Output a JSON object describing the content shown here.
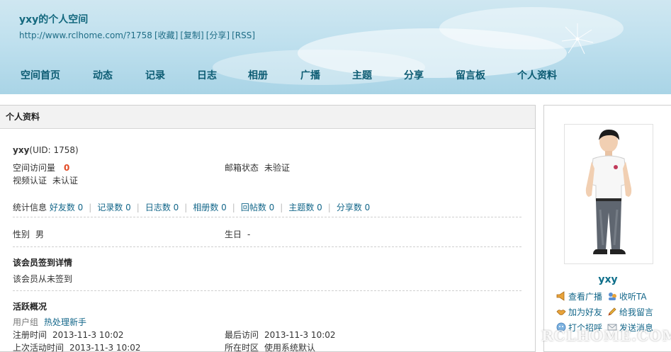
{
  "header": {
    "title": "yxy的个人空间",
    "url": "http://www.rclhome.com/?1758",
    "url_links": [
      "[收藏]",
      "[复制]",
      "[分享]",
      "[RSS]"
    ]
  },
  "nav": [
    "空间首页",
    "动态",
    "记录",
    "日志",
    "相册",
    "广播",
    "主题",
    "分享",
    "留言板",
    "个人资料"
  ],
  "main": {
    "panel_title": "个人资料",
    "user_line": "yxy",
    "uid": "(UID: 1758)",
    "visits_label": "空间访问量",
    "visits_value": "0",
    "email_label": "邮箱状态",
    "email_value": "未验证",
    "video_label": "视频认证",
    "video_value": "未认证",
    "stats_label": "统计信息",
    "stats": [
      "好友数 0",
      "记录数 0",
      "日志数 0",
      "相册数 0",
      "回帖数 0",
      "主题数 0",
      "分享数 0"
    ],
    "gender_label": "性别",
    "gender_value": "男",
    "birthday_label": "生日",
    "birthday_value": "-",
    "signin_title": "该会员签到详情",
    "signin_text": "该会员从未签到",
    "activity_title": "活跃概况",
    "usergroup_label": "用户组",
    "usergroup_value": "热处理新手",
    "reg_label": "注册时间",
    "reg_value": "2013-11-3 10:02",
    "last_visit_label": "最后访问",
    "last_visit_value": "2013-11-3 10:02",
    "last_active_label": "上次活动时间",
    "last_active_value": "2013-11-3 10:02",
    "timezone_label": "所在时区",
    "timezone_value": "使用系统默认"
  },
  "sidebar": {
    "username": "yxy",
    "actions": [
      "查看广播",
      "收听TA",
      "加为好友",
      "给我留言",
      "打个招呼",
      "发送消息"
    ]
  },
  "watermark": "RCLHOME.COM"
}
